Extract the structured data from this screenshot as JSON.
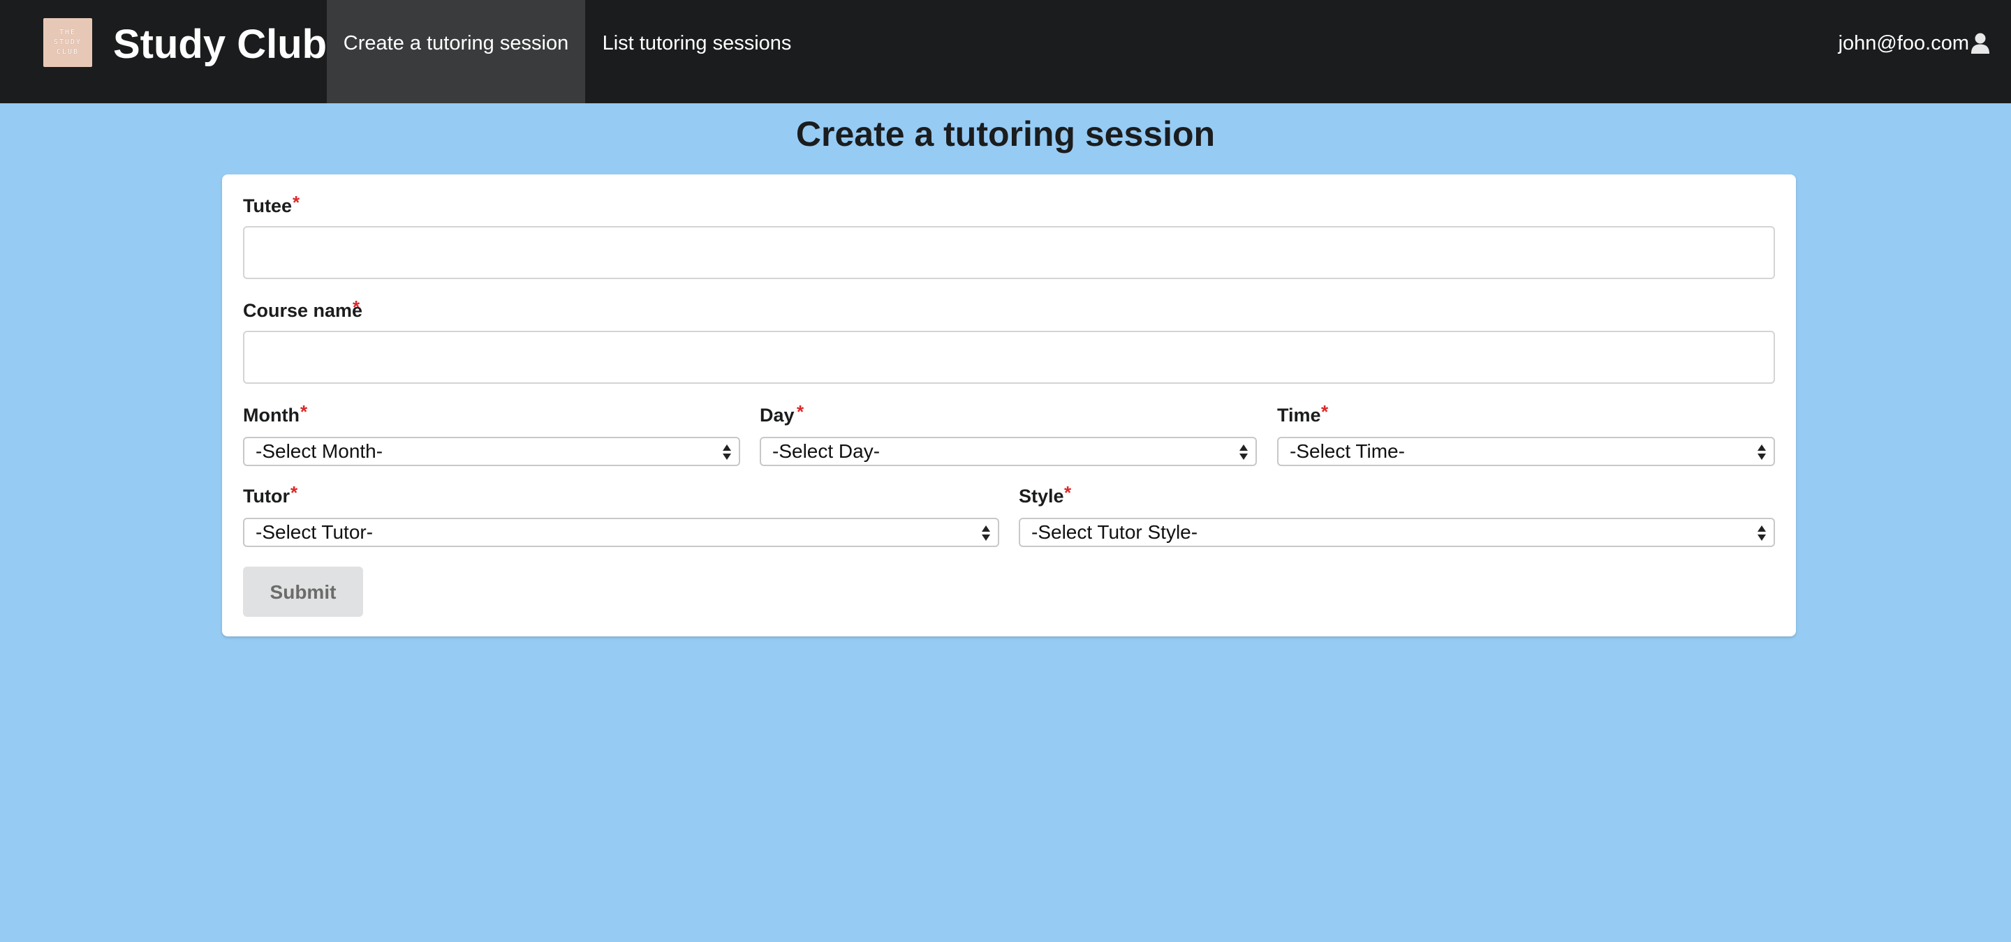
{
  "navbar": {
    "logo_lines": [
      "THE",
      "STUDY",
      "CLUB"
    ],
    "brand": "Study Club",
    "items": [
      {
        "label": "Create a tutoring session",
        "active": true
      },
      {
        "label": "List tutoring sessions",
        "active": false
      }
    ],
    "user_email": "john@foo.com",
    "user_icon": "user-icon"
  },
  "page": {
    "title": "Create a tutoring session"
  },
  "form": {
    "required_marker": "*",
    "tutee": {
      "label": "Tutee",
      "value": "",
      "placeholder": ""
    },
    "course_name": {
      "label": "Course name",
      "value": "",
      "placeholder": ""
    },
    "month": {
      "label": "Month",
      "selected": "-Select Month-"
    },
    "day": {
      "label": "Day",
      "selected": "-Select Day-"
    },
    "time": {
      "label": "Time",
      "selected": "-Select Time-"
    },
    "tutor": {
      "label": "Tutor",
      "selected": "-Select Tutor-"
    },
    "style": {
      "label": "Style",
      "selected": "-Select Tutor Style-"
    },
    "submit_label": "Submit"
  },
  "colors": {
    "background": "#96cbf4",
    "navbar": "#1b1c1d",
    "nav_active": "#3a3b3c",
    "required": "#db2828",
    "button": "#e0e1e2"
  }
}
